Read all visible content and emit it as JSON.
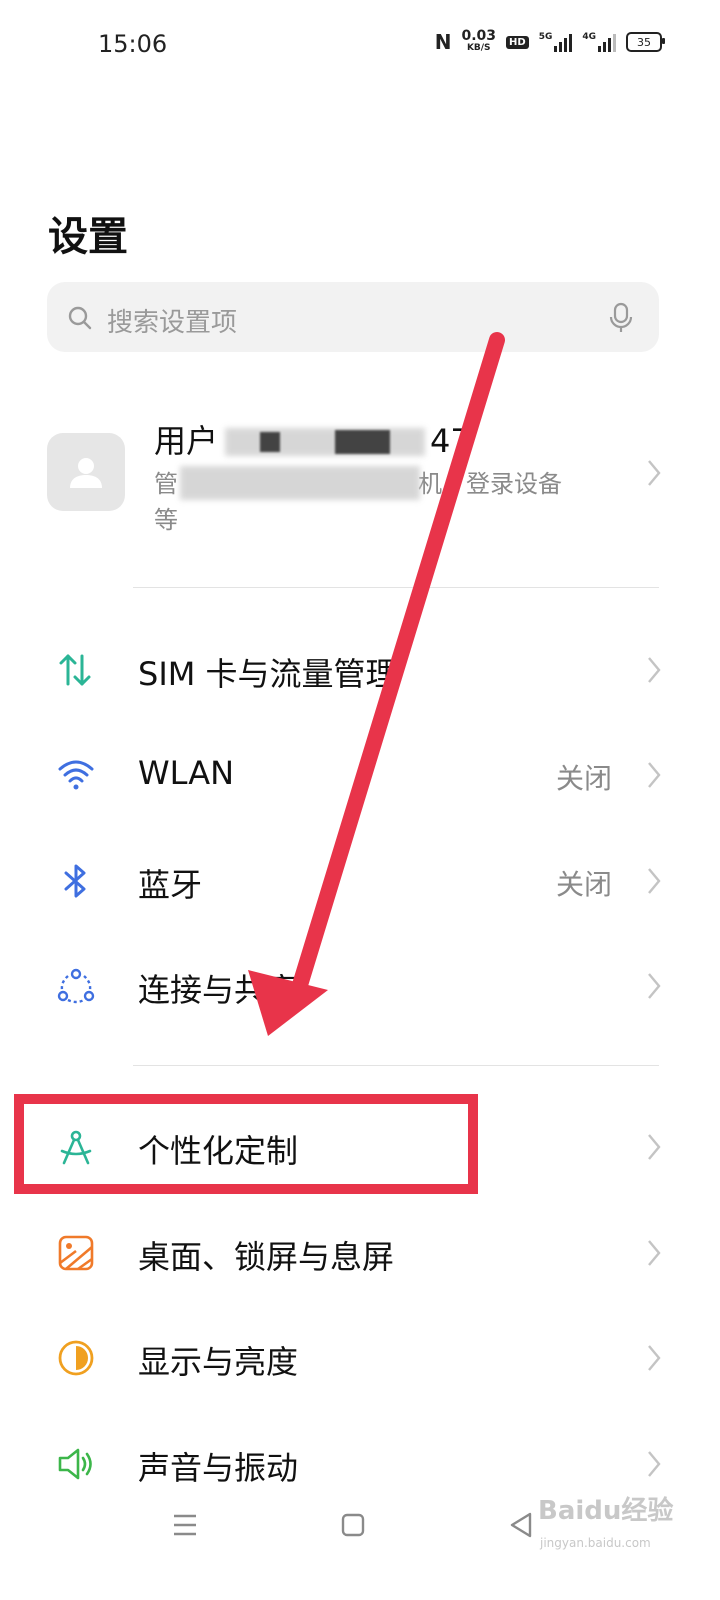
{
  "status_bar": {
    "time": "15:06",
    "nfc": "N",
    "speed_value": "0.03",
    "speed_unit": "KB/S",
    "hd": "HD",
    "sig1_label": "5G",
    "sig2_label": "4G",
    "battery": "35"
  },
  "page": {
    "title": "设置"
  },
  "search": {
    "placeholder": "搜索设置项"
  },
  "account": {
    "name_prefix": "用户",
    "name_suffix": "47",
    "subtitle_prefix": "管",
    "subtitle_suffix": "机、登录设备",
    "subtitle_line2": "等"
  },
  "items": [
    {
      "id": "sim",
      "label": "SIM 卡与流量管理",
      "value": "",
      "icon": "data-transfer-icon",
      "color": "#2bb596"
    },
    {
      "id": "wlan",
      "label": "WLAN",
      "value": "关闭",
      "icon": "wifi-icon",
      "color": "#3f6fe0"
    },
    {
      "id": "bluetooth",
      "label": "蓝牙",
      "value": "关闭",
      "icon": "bluetooth-icon",
      "color": "#3f6fe0"
    },
    {
      "id": "connection",
      "label": "连接与共享",
      "value": "",
      "icon": "connection-share-icon",
      "color": "#3f6fe0"
    },
    {
      "id": "personalize",
      "label": "个性化定制",
      "value": "",
      "icon": "personalize-icon",
      "color": "#2bb596"
    },
    {
      "id": "desktop",
      "label": "桌面、锁屏与息屏",
      "value": "",
      "icon": "wallpaper-icon",
      "color": "#f07a2a"
    },
    {
      "id": "display",
      "label": "显示与亮度",
      "value": "",
      "icon": "brightness-icon",
      "color": "#f0a020"
    },
    {
      "id": "sound",
      "label": "声音与振动",
      "value": "",
      "icon": "speaker-icon",
      "color": "#3cb64a"
    }
  ],
  "watermark": {
    "brand": "Baidu经验",
    "url": "jingyan.baidu.com"
  },
  "colors": {
    "highlight": "#e8344a",
    "arrow": "#e8344a"
  }
}
